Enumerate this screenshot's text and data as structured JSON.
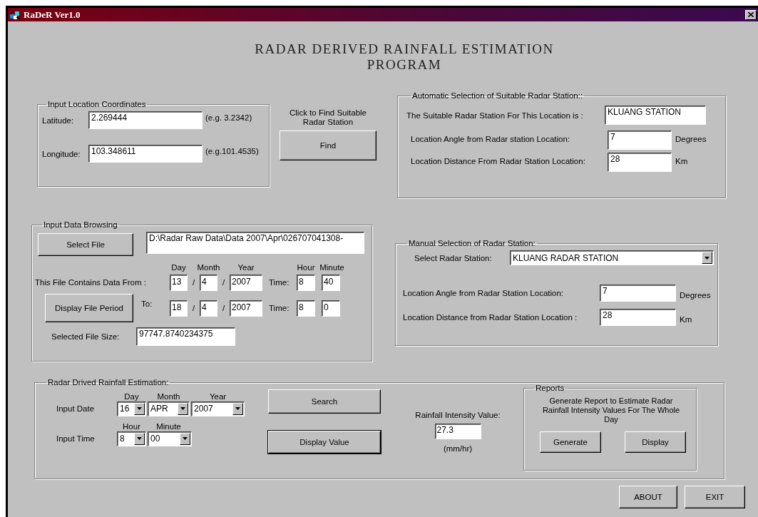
{
  "window": {
    "title": "RaDeR Ver1.0"
  },
  "heading": [
    "RADAR DERIVED RAINFALL ESTIMATION",
    "PROGRAM"
  ],
  "location_group": {
    "title": "Input Location Coordinates",
    "fields": [
      {
        "label": "Latitude:",
        "value": "2.269444",
        "hint": "(e.g. 3.2342)"
      },
      {
        "label": "Longitude:",
        "value": "103.348611",
        "hint": "(e.g.101.4535)"
      }
    ]
  },
  "find": {
    "caption": "Click to Find Suitable Radar Station",
    "button": "Find"
  },
  "auto_group": {
    "title": "Automatic Selection of  Suitable Radar Station::",
    "station_label": "The Suitable Radar Station For This Location is :",
    "station": "KLUANG STATION",
    "rows": [
      {
        "label": "Location Angle from Radar station  Location:",
        "value": "7",
        "unit": "Degrees"
      },
      {
        "label": "Location Distance From Radar Station Location:",
        "value": "28",
        "unit": "Km"
      }
    ]
  },
  "browse_group": {
    "title": "Input Data Browsing",
    "select_button": "Select File",
    "file_path": "D:\\Radar Raw Data\\Data 2007\\Apr\\026707041308-",
    "headers": [
      "Day",
      "Month",
      "Year",
      "Hour",
      "Minute"
    ],
    "periods": [
      {
        "label": "This File Contains Data From :",
        "day": "13",
        "sep1": "/",
        "month": "4",
        "sep2": "/",
        "year": "2007",
        "time_label": "Time:",
        "hour": "8",
        "minute": "40"
      },
      {
        "button": "Display File Period",
        "label": "To:",
        "day": "18",
        "sep1": "/",
        "month": "4",
        "sep2": "/",
        "year": "2007",
        "time_label": "Time:",
        "hour": "8",
        "minute": "0"
      }
    ],
    "size_label": "Selected File Size:",
    "size": "97747.8740234375"
  },
  "manual_group": {
    "title": "Manual Selection of Radar Station:",
    "select_label": "Select  Radar Station:",
    "station": "KLUANG RADAR STATION",
    "rows": [
      {
        "label": "Location Angle from Radar Station Location:",
        "value": "7",
        "unit": "Degrees"
      },
      {
        "label": "Location Distance from Radar Station Location :",
        "value": "28",
        "unit": "Km"
      }
    ]
  },
  "estimation_group": {
    "title": "Radar Drived Rainfall Estimation:",
    "date_label": "Input Date",
    "date_headers": [
      "Day",
      "Month",
      "Year"
    ],
    "date": [
      "16",
      "APR",
      "2007"
    ],
    "time_label": "Input Time",
    "time_headers": [
      "Hour",
      "Minute"
    ],
    "time": [
      "8",
      "00"
    ],
    "buttons": [
      {
        "label": "Search",
        "focused": false
      },
      {
        "label": "Display Value",
        "focused": true
      }
    ],
    "intensity_label": "Rainfall Intensity Value:",
    "intensity": "27.3",
    "intensity_unit": "(mm/hr)",
    "reports": {
      "title": "Reports",
      "text": "Generate Report to Estimate Radar Rainfall Intensity Values For The Whole Day",
      "buttons": [
        "Generate",
        "Display"
      ]
    }
  },
  "buttons": [
    "ABOUT",
    "EXIT"
  ]
}
